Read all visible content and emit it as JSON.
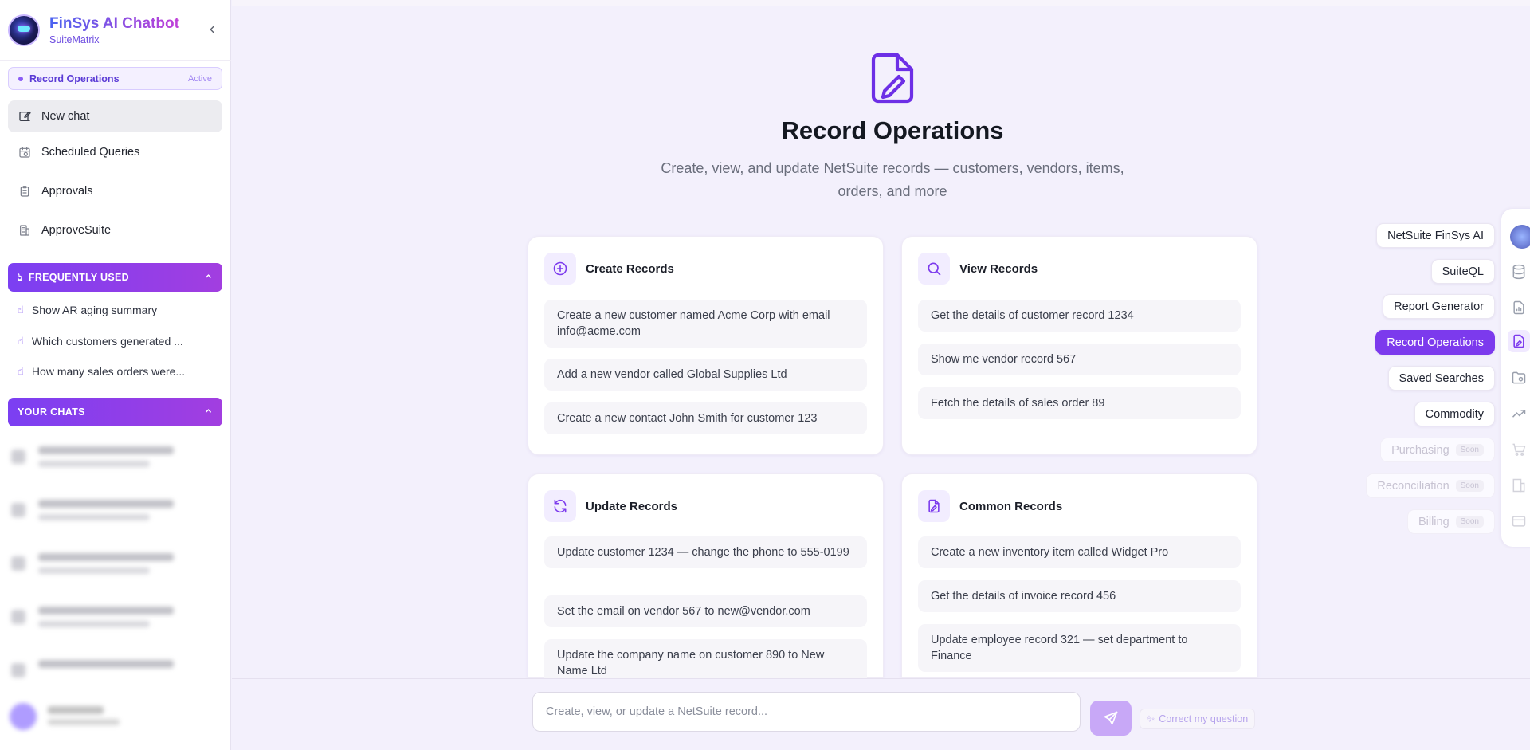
{
  "brand": {
    "title": "FinSys AI Chatbot",
    "subtitle": "SuiteMatrix"
  },
  "active_mode": {
    "label": "Record Operations",
    "badge": "Active"
  },
  "nav": [
    {
      "label": "New chat",
      "icon": "edit-icon"
    },
    {
      "label": "Scheduled Queries",
      "icon": "calendar-clock-icon"
    },
    {
      "label": "Approvals",
      "icon": "clipboard-icon"
    },
    {
      "label": "ApproveSuite",
      "icon": "building-icon"
    }
  ],
  "frequently_used": {
    "title": "FREQUENTLY USED",
    "items": [
      "Show AR aging summary",
      "Which customers generated ...",
      "How many sales orders were..."
    ]
  },
  "your_chats": {
    "title": "YOUR CHATS"
  },
  "hero": {
    "title": "Record Operations",
    "subtitle": "Create, view, and update NetSuite records — customers, vendors, items, orders, and more"
  },
  "cards": [
    {
      "title": "Create Records",
      "icon": "plus-circle-icon",
      "prompts": [
        "Create a new customer named Acme Corp with email info@acme.com",
        "Add a new vendor called Global Supplies Ltd",
        "Create a new contact John Smith for customer 123"
      ]
    },
    {
      "title": "View Records",
      "icon": "search-icon",
      "prompts": [
        "Get the details of customer record 1234",
        "Show me vendor record 567",
        "Fetch the details of sales order 89"
      ]
    },
    {
      "title": "Update Records",
      "icon": "refresh-icon",
      "prompts": [
        "Update customer 1234 — change the phone to 555-0199",
        "Set the email on vendor 567 to new@vendor.com",
        "Update the company name on customer 890 to New Name Ltd"
      ]
    },
    {
      "title": "Common Records",
      "icon": "file-edit-icon",
      "prompts": [
        "Create a new inventory item called Widget Pro",
        "Get the details of invoice record 456",
        "Update employee record 321 — set department to Finance"
      ]
    }
  ],
  "modes": [
    {
      "label": "NetSuite FinSys AI",
      "state": "normal"
    },
    {
      "label": "SuiteQL",
      "state": "normal"
    },
    {
      "label": "Report Generator",
      "state": "normal"
    },
    {
      "label": "Record Operations",
      "state": "active"
    },
    {
      "label": "Saved Searches",
      "state": "normal"
    },
    {
      "label": "Commodity",
      "state": "normal"
    },
    {
      "label": "Purchasing",
      "state": "disabled",
      "badge": "Soon"
    },
    {
      "label": "Reconciliation",
      "state": "disabled",
      "badge": "Soon"
    },
    {
      "label": "Billing",
      "state": "disabled",
      "badge": "Soon"
    }
  ],
  "composer": {
    "placeholder": "Create, view, or update a NetSuite record...",
    "correct_label": "Correct my question"
  },
  "colors": {
    "accent": "#7c3aed",
    "page_bg": "#f3f0fc",
    "section_gradient_start": "#7b3ff2",
    "section_gradient_end": "#a23ee0"
  }
}
